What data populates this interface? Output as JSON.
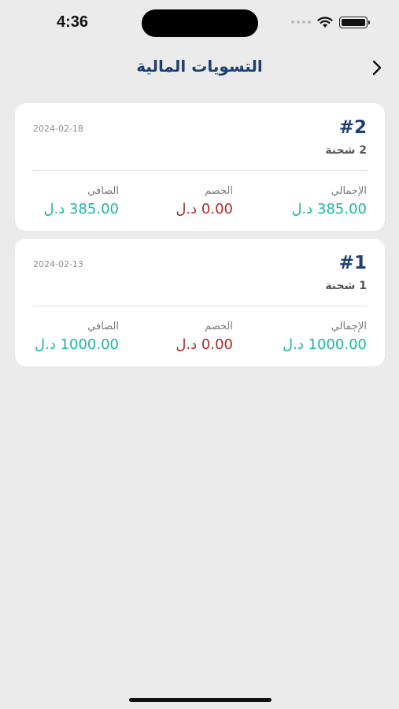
{
  "status_bar": {
    "time": "4:36"
  },
  "header": {
    "title": "التسويات المالية"
  },
  "labels": {
    "total": "الإجمالي",
    "discount": "الخصم",
    "net": "الصافي"
  },
  "colors": {
    "title": "#1f3f73",
    "positive": "#1fb3a6",
    "negative": "#b02a2a"
  },
  "settlements": [
    {
      "number": "#2",
      "shipments": "2 شحنة",
      "date": "2024-02-18",
      "total": "385.00 د.ل",
      "discount": "0.00 د.ل",
      "net": "385.00 د.ل"
    },
    {
      "number": "#1",
      "shipments": "1 شحنة",
      "date": "2024-02-13",
      "total": "1000.00 د.ل",
      "discount": "0.00 د.ل",
      "net": "1000.00 د.ل"
    }
  ]
}
